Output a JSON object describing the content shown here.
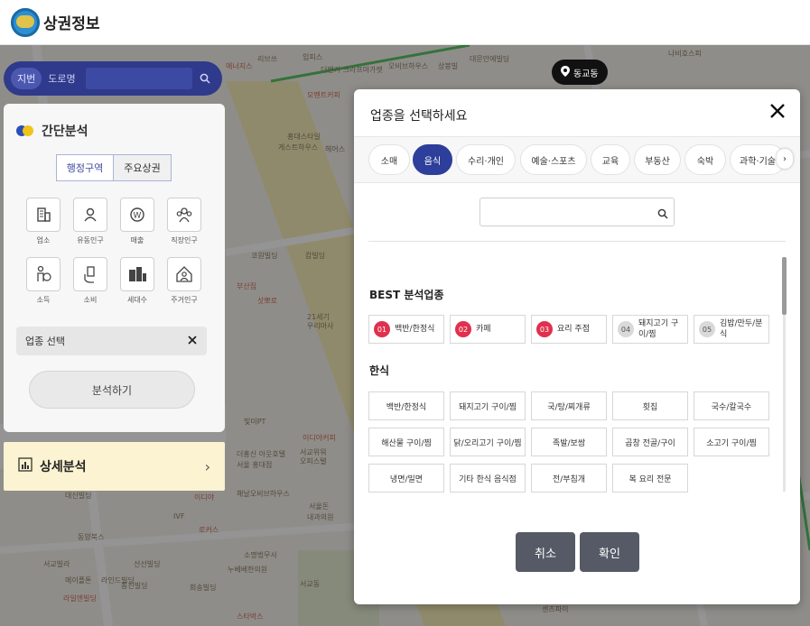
{
  "header": {
    "app_title": "상권정보"
  },
  "map": {
    "labels": [
      {
        "text": "에너지스",
        "red": true
      },
      {
        "text": "리브쓰"
      },
      {
        "text": "임피스"
      },
      {
        "text": "더밴커 크라프마가렛"
      },
      {
        "text": "오비브하우스"
      },
      {
        "text": "상봉빌"
      },
      {
        "text": "대문안에빌딩"
      },
      {
        "text": "나비호스피"
      },
      {
        "text": "모멘트커피",
        "red": true
      },
      {
        "text": "홍대스타일"
      },
      {
        "text": "게스트하우스"
      },
      {
        "text": "헤어스"
      },
      {
        "text": "코원빌딩"
      },
      {
        "text": "캄빌딩"
      },
      {
        "text": "부산집",
        "red": true
      },
      {
        "text": "삿뽀로",
        "red": true
      },
      {
        "text": "21세기"
      },
      {
        "text": "우리마사"
      },
      {
        "text": "빛미PT"
      },
      {
        "text": "이디야커피",
        "red": true
      },
      {
        "text": "더홍신 아웃호텔"
      },
      {
        "text": "서울 홍대점"
      },
      {
        "text": "서교위워"
      },
      {
        "text": "오피스텔"
      },
      {
        "text": "대신빌딩"
      },
      {
        "text": "해날오비브하우스"
      },
      {
        "text": "서울돈"
      },
      {
        "text": "내과의원"
      },
      {
        "text": "이디야",
        "red": true
      },
      {
        "text": "IVF"
      },
      {
        "text": "로커스",
        "red": true
      },
      {
        "text": "소명법무사"
      },
      {
        "text": "누베베한의원"
      },
      {
        "text": "서교빌라"
      },
      {
        "text": "선선빌딩"
      },
      {
        "text": "메이플톤"
      },
      {
        "text": "라인드빌딩"
      },
      {
        "text": "회송빌딩"
      },
      {
        "text": "서교동"
      },
      {
        "text": "동양북스"
      },
      {
        "text": "동진빌딩"
      },
      {
        "text": "라일엔빌딩",
        "red": true
      },
      {
        "text": "스타박스",
        "red": true
      },
      {
        "text": "센즈파이"
      }
    ]
  },
  "search": {
    "tab_jibun": "지번",
    "tab_road": "도로명"
  },
  "location": {
    "label": "동교동"
  },
  "left_panel": {
    "title": "간단분석",
    "area_tabs": [
      "행정구역",
      "주요상권"
    ],
    "grid": [
      {
        "label": "업소",
        "icon": "building-icon"
      },
      {
        "label": "유동인구",
        "icon": "person-icon"
      },
      {
        "label": "매출",
        "icon": "won-coin-icon"
      },
      {
        "label": "직장인구",
        "icon": "group-icon"
      },
      {
        "label": "소득",
        "icon": "income-person-icon"
      },
      {
        "label": "소비",
        "icon": "hand-card-icon"
      },
      {
        "label": "세대수",
        "icon": "apartment-icon"
      },
      {
        "label": "주거인구",
        "icon": "house-person-icon"
      }
    ],
    "industry_select": "업종 선택",
    "analyze_button": "분석하기",
    "detail_title": "상세분석"
  },
  "modal": {
    "title": "업종을 선택하세요",
    "categories": [
      {
        "label": "소매"
      },
      {
        "label": "음식",
        "active": true
      },
      {
        "label": "수리·개인"
      },
      {
        "label": "예술·스포츠"
      },
      {
        "label": "교육"
      },
      {
        "label": "부동산"
      },
      {
        "label": "숙박"
      },
      {
        "label": "과학·기술"
      }
    ],
    "best_title": "BEST 분석업종",
    "best": [
      {
        "rank": "01",
        "name": "백반/한정식",
        "color": "red"
      },
      {
        "rank": "02",
        "name": "카페",
        "color": "red"
      },
      {
        "rank": "03",
        "name": "요리 주점",
        "color": "red"
      },
      {
        "rank": "04",
        "name": "돼지고기 구이/찜",
        "color": "gray"
      },
      {
        "rank": "05",
        "name": "김밥/만두/분식",
        "color": "gray"
      }
    ],
    "korean_title": "한식",
    "korean": [
      "백반/한정식",
      "돼지고기 구이/찜",
      "국/탕/찌개류",
      "횟집",
      "국수/칼국수",
      "해산물 구이/찜",
      "닭/오리고기 구이/찜",
      "족발/보쌈",
      "곱창 전골/구이",
      "소고기 구이/찜",
      "냉면/밀면",
      "기타 한식 음식점",
      "전/부침개",
      "복 요리 전문"
    ],
    "cancel_button": "취소",
    "confirm_button": "확인"
  },
  "colors": {
    "accent_blue": "#2d3f9a",
    "rank_red": "#e0304d",
    "search_bar": "#2f3a8c",
    "button_gray": "#555a66"
  }
}
